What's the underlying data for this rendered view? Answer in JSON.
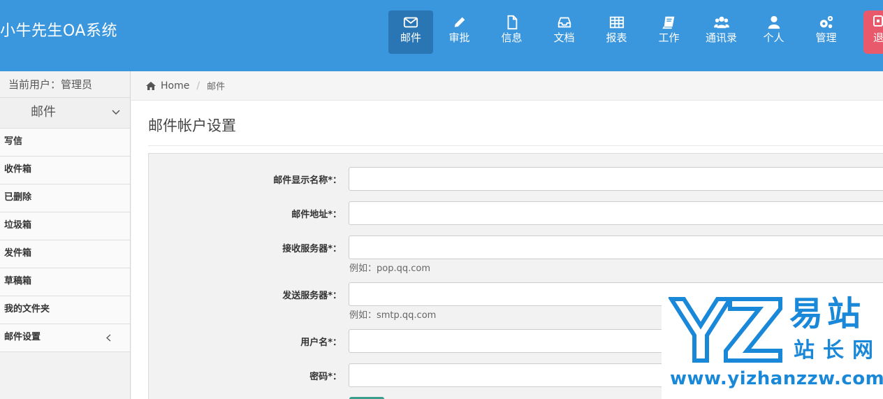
{
  "header": {
    "brand": "小牛先生OA系统",
    "nav": [
      {
        "label": "邮件",
        "icon": "envelope-icon",
        "active": true
      },
      {
        "label": "审批",
        "icon": "pencil-icon",
        "active": false
      },
      {
        "label": "信息",
        "icon": "file-icon",
        "active": false
      },
      {
        "label": "文档",
        "icon": "inbox-icon",
        "active": false
      },
      {
        "label": "报表",
        "icon": "table-icon",
        "active": false
      },
      {
        "label": "工作",
        "icon": "book-icon",
        "active": false
      },
      {
        "label": "通讯录",
        "icon": "users-icon",
        "active": false
      },
      {
        "label": "个人",
        "icon": "user-icon",
        "active": false
      },
      {
        "label": "管理",
        "icon": "gears-icon",
        "active": false
      }
    ],
    "exit_label": "退",
    "colors": {
      "bar": "#3a96dd",
      "active": "#2a76b5",
      "exit": "#e85a6b"
    }
  },
  "sidebar": {
    "current_user": "当前用户：管理员",
    "section_title": "邮件",
    "items": [
      {
        "label": "写信"
      },
      {
        "label": "收件箱"
      },
      {
        "label": "已删除"
      },
      {
        "label": "垃圾箱"
      },
      {
        "label": "发件箱"
      },
      {
        "label": "草稿箱"
      },
      {
        "label": "我的文件夹"
      },
      {
        "label": "邮件设置"
      }
    ]
  },
  "breadcrumb": {
    "home": "Home",
    "separator": "/",
    "current": "邮件"
  },
  "main": {
    "title": "邮件帐户设置",
    "form": {
      "display_name": {
        "label": "邮件显示名称*：",
        "value": ""
      },
      "address": {
        "label": "邮件地址*：",
        "value": ""
      },
      "incoming": {
        "label": "接收服务器*：",
        "value": "",
        "help": "例如：pop.qq.com"
      },
      "outgoing": {
        "label": "发送服务器*：",
        "value": "",
        "help": "例如：smtp.qq.com"
      },
      "username": {
        "label": "用户名*：",
        "value": ""
      },
      "password": {
        "label": "密码*：",
        "value": ""
      }
    }
  },
  "watermark": {
    "logo_letters": "YZ",
    "cn_top": "易站",
    "cn_bottom": "站长网",
    "url": "www.yizhanzzw.com",
    "color": "#1a88d8"
  }
}
